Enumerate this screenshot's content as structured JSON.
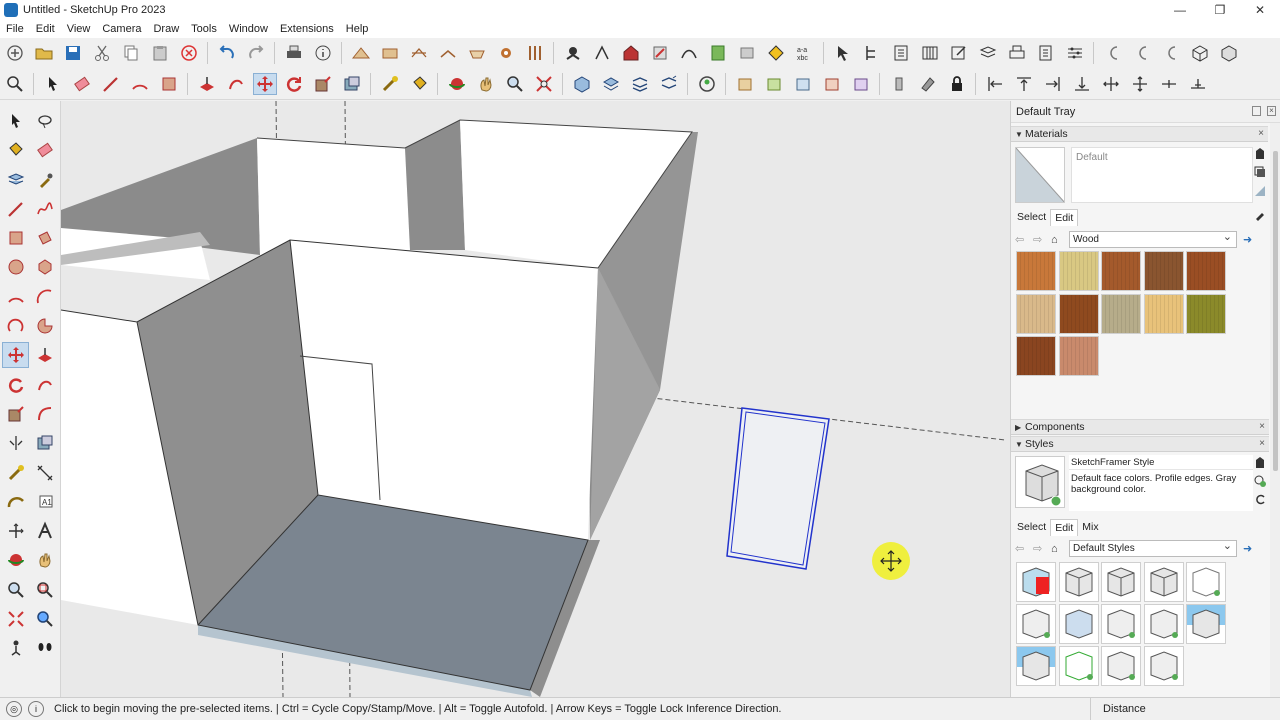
{
  "window": {
    "title": "Untitled - SketchUp Pro 2023",
    "minimize": "—",
    "maximize": "❐",
    "close": "✕"
  },
  "menu": [
    "File",
    "Edit",
    "View",
    "Camera",
    "Draw",
    "Tools",
    "Window",
    "Extensions",
    "Help"
  ],
  "tray": {
    "title": "Default Tray",
    "materials": {
      "heading": "Materials",
      "current": "Default",
      "tabs": [
        "Select",
        "Edit"
      ],
      "library": "Wood",
      "swatch_colors": [
        "#c8783a",
        "#d9c883",
        "#a45a2c",
        "#8a5530",
        "#9a4e24",
        "#d9b98a",
        "#8f4a1f",
        "#b6ac8a",
        "#e8c27a",
        "#8b8a2a",
        "#8a4520",
        "#c98a6c"
      ]
    },
    "components": {
      "heading": "Components"
    },
    "styles": {
      "heading": "Styles",
      "name": "SketchFramer Style",
      "description": "Default face colors. Profile edges. Gray background color.",
      "tabs": [
        "Select",
        "Edit",
        "Mix"
      ],
      "library": "Default Styles"
    }
  },
  "status": {
    "message": "Click to begin moving the pre-selected items. | Ctrl = Cycle Copy/Stamp/Move. | Alt = Toggle Autofold. | Arrow Keys = Toggle Lock Inference Direction.",
    "measurements_label": "Distance"
  }
}
